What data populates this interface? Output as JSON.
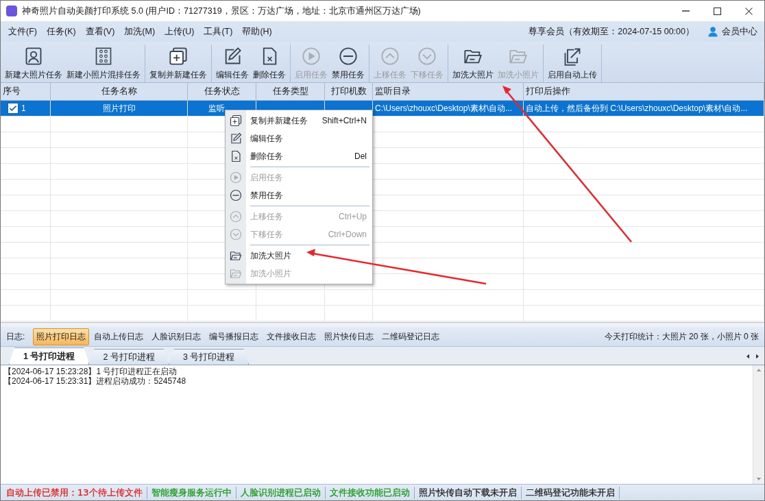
{
  "window": {
    "title": "神奇照片自动美颜打印系统 5.0 (用户ID：71277319，景区：万达广场，地址：北京市通州区万达广场)"
  },
  "menu_bar": {
    "items": [
      "文件(F)",
      "任务(K)",
      "查看(V)",
      "加洗(M)",
      "上传(U)",
      "工具(T)",
      "帮助(H)"
    ],
    "membership": "尊享会员（有效期至：2024-07-15 00:00）",
    "member_center": "会员中心"
  },
  "toolbar": {
    "groups": [
      [
        {
          "label": "新建大照片任务",
          "kind": "portrait",
          "disabled": false
        },
        {
          "label": "新建小照片混排任务",
          "kind": "grid",
          "disabled": false
        }
      ],
      [
        {
          "label": "复制并新建任务",
          "kind": "copy",
          "disabled": false
        }
      ],
      [
        {
          "label": "编辑任务",
          "kind": "edit",
          "disabled": false
        },
        {
          "label": "删除任务",
          "kind": "delete",
          "disabled": false
        }
      ],
      [
        {
          "label": "启用任务",
          "kind": "play",
          "disabled": true
        },
        {
          "label": "禁用任务",
          "kind": "minus",
          "disabled": false
        }
      ],
      [
        {
          "label": "上移任务",
          "kind": "up",
          "disabled": true
        },
        {
          "label": "下移任务",
          "kind": "down",
          "disabled": true
        }
      ],
      [
        {
          "label": "加洗大照片",
          "kind": "folder",
          "disabled": false
        },
        {
          "label": "加洗小照片",
          "kind": "folder",
          "disabled": true
        }
      ],
      [
        {
          "label": "启用自动上传",
          "kind": "upload",
          "disabled": false
        }
      ]
    ]
  },
  "table": {
    "columns": [
      "序号",
      "任务名称",
      "任务状态",
      "任务类型",
      "打印机数",
      "监听目录",
      "打印后操作"
    ],
    "rows": [
      {
        "checked": true,
        "selected": true,
        "index": "1",
        "name": "照片打印",
        "status": "监听",
        "directory": "C:\\Users\\zhouxc\\Desktop\\素材\\自动...",
        "after_print": "自动上传，然后备份到 C:\\Users\\zhouxc\\Desktop\\素材\\自动..."
      }
    ]
  },
  "context_menu": {
    "groups": [
      [
        {
          "kind": "copy",
          "label": "复制并新建任务",
          "shortcut": "Shift+Ctrl+N",
          "disabled": false
        },
        {
          "kind": "edit",
          "label": "编辑任务",
          "disabled": false
        },
        {
          "kind": "delete",
          "label": "删除任务",
          "shortcut": "Del",
          "disabled": false
        }
      ],
      [
        {
          "kind": "play",
          "label": "启用任务",
          "disabled": true
        },
        {
          "kind": "minus",
          "label": "禁用任务",
          "disabled": false
        }
      ],
      [
        {
          "kind": "up",
          "label": "上移任务",
          "shortcut": "Ctrl+Up",
          "disabled": true
        },
        {
          "kind": "down",
          "label": "下移任务",
          "shortcut": "Ctrl+Down",
          "disabled": true
        }
      ],
      [
        {
          "kind": "folder",
          "label": "加洗大照片",
          "disabled": false
        },
        {
          "kind": "folder",
          "label": "加洗小照片",
          "disabled": true
        }
      ]
    ]
  },
  "log_bar": {
    "label": "日志:",
    "tabs": [
      {
        "label": "照片打印日志",
        "selected": true
      },
      {
        "label": "自动上传日志",
        "selected": false
      },
      {
        "label": "人脸识别日志",
        "selected": false
      },
      {
        "label": "编号播报日志",
        "selected": false
      },
      {
        "label": "文件接收日志",
        "selected": false
      },
      {
        "label": "照片快传日志",
        "selected": false
      },
      {
        "label": "二维码登记日志",
        "selected": false
      }
    ],
    "stats": "今天打印统计：大照片 20 张，小照片 0 张"
  },
  "process_tabs": [
    {
      "label": "1 号打印进程",
      "selected": true
    },
    {
      "label": "2 号打印进程",
      "selected": false
    },
    {
      "label": "3 号打印进程",
      "selected": false
    }
  ],
  "log_lines": [
    "【2024-06-17 15:23:28】1 号打印进程正在启动",
    "【2024-06-17 15:23:31】进程启动成功：5245748"
  ],
  "status_bar": [
    {
      "text": "自动上传已禁用：13个待上传文件",
      "color": "#e0201b"
    },
    {
      "text": "智能瘦身服务运行中",
      "color": "#1a9a1a"
    },
    {
      "text": "人脸识别进程已启动",
      "color": "#1a9a1a"
    },
    {
      "text": "文件接收功能已启动",
      "color": "#1a9a1a"
    },
    {
      "text": "照片快传自动下载未开启",
      "color": "#222222"
    },
    {
      "text": "二维码登记功能未开启",
      "color": "#222222"
    }
  ]
}
